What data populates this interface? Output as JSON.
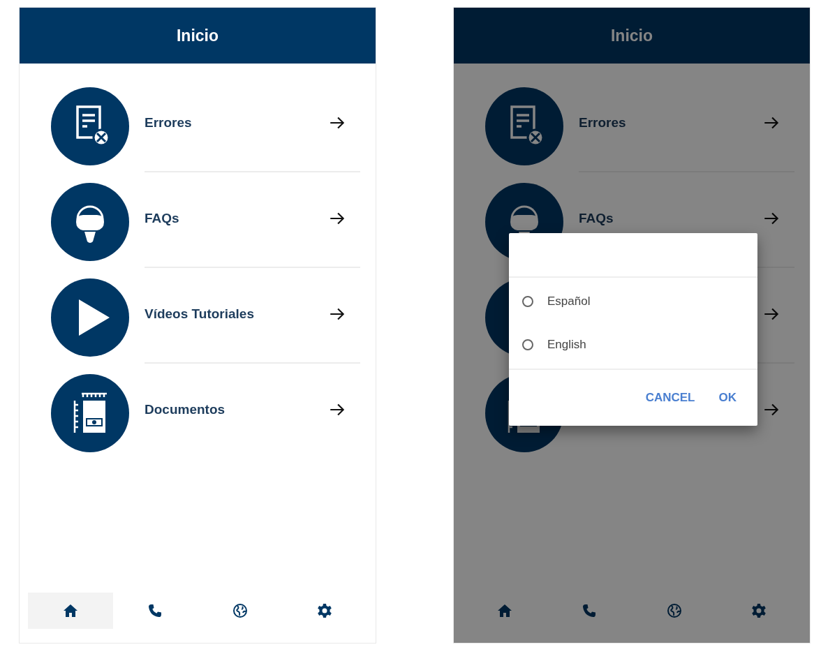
{
  "screens": [
    {
      "title": "Inicio",
      "items": [
        {
          "kind": "errors",
          "label": "Errores"
        },
        {
          "kind": "faq",
          "label": "FAQs"
        },
        {
          "kind": "video",
          "label": "Vídeos Tutoriales"
        },
        {
          "kind": "documents",
          "label": "Documentos"
        }
      ],
      "nav": [
        {
          "kind": "home",
          "selected": true
        },
        {
          "kind": "phone",
          "selected": false
        },
        {
          "kind": "globe",
          "selected": false
        },
        {
          "kind": "settings",
          "selected": false
        }
      ]
    },
    {
      "title": "Inicio",
      "items": [
        {
          "kind": "errors",
          "label": "Errores"
        },
        {
          "kind": "faq",
          "label": "FAQs"
        },
        {
          "kind": "video"
        },
        {
          "kind": "documents"
        }
      ],
      "nav": [
        {
          "kind": "home"
        },
        {
          "kind": "phone"
        },
        {
          "kind": "globe"
        },
        {
          "kind": "settings"
        }
      ],
      "dialog": {
        "options": [
          {
            "label": "Español",
            "selected": false
          },
          {
            "label": "English",
            "selected": false
          }
        ],
        "buttons": [
          "CANCEL",
          "OK"
        ]
      }
    }
  ]
}
